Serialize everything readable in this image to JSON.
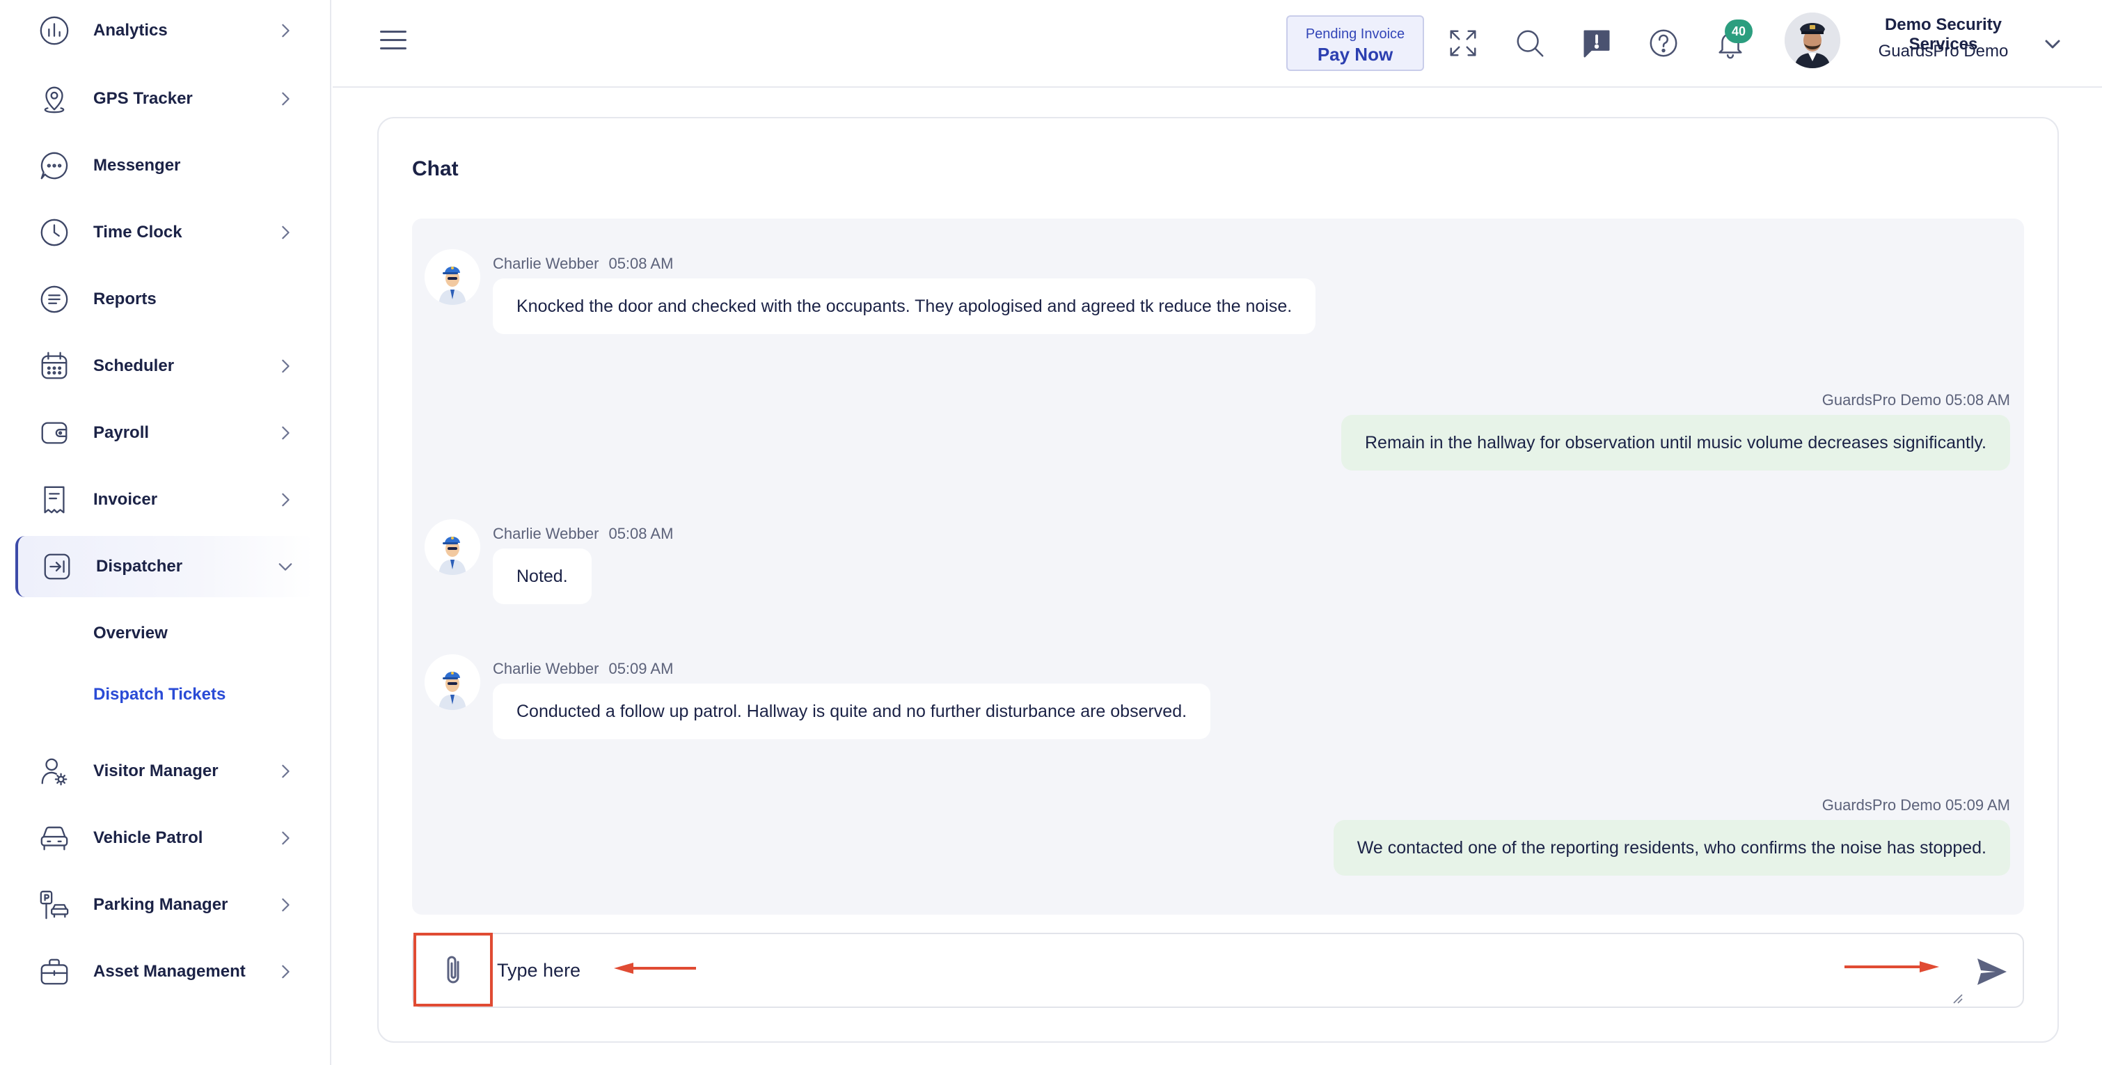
{
  "sidebar": {
    "items": [
      {
        "label": "Analytics",
        "icon": "analytics-icon",
        "has_chevron": true
      },
      {
        "label": "GPS Tracker",
        "icon": "location-pin-icon",
        "has_chevron": true
      },
      {
        "label": "Messenger",
        "icon": "chat-bubble-icon",
        "has_chevron": false
      },
      {
        "label": "Time Clock",
        "icon": "clock-icon",
        "has_chevron": true
      },
      {
        "label": "Reports",
        "icon": "report-icon",
        "has_chevron": false
      },
      {
        "label": "Scheduler",
        "icon": "calendar-icon",
        "has_chevron": true
      },
      {
        "label": "Payroll",
        "icon": "wallet-icon",
        "has_chevron": true
      },
      {
        "label": "Invoicer",
        "icon": "receipt-icon",
        "has_chevron": true
      },
      {
        "label": "Dispatcher",
        "icon": "dispatch-icon",
        "has_chevron": true,
        "expanded": true
      },
      {
        "label": "Visitor Manager",
        "icon": "visitor-icon",
        "has_chevron": true
      },
      {
        "label": "Vehicle Patrol",
        "icon": "car-icon",
        "has_chevron": true
      },
      {
        "label": "Parking Manager",
        "icon": "parking-icon",
        "has_chevron": true
      },
      {
        "label": "Asset Management",
        "icon": "briefcase-icon",
        "has_chevron": true
      }
    ],
    "dispatcher_sub": [
      {
        "label": "Overview",
        "active": false
      },
      {
        "label": "Dispatch Tickets",
        "active": true
      }
    ]
  },
  "header": {
    "pending_invoice": "Pending Invoice",
    "pay_now": "Pay Now",
    "notification_count": "40",
    "user_name": "Demo Security Services",
    "user_org": "GuardsPro Demo"
  },
  "chat": {
    "title": "Chat",
    "messages": [
      {
        "direction": "in",
        "sender": "Charlie Webber",
        "time": "05:08 AM",
        "text": "Knocked the door and checked with the occupants. They apologised and agreed tk reduce the noise."
      },
      {
        "direction": "out",
        "meta": "GuardsPro Demo 05:08 AM",
        "text": "Remain in the hallway for observation until music volume decreases significantly."
      },
      {
        "direction": "in",
        "sender": "Charlie Webber",
        "time": "05:08 AM",
        "text": "Noted."
      },
      {
        "direction": "in",
        "sender": "Charlie Webber",
        "time": "05:09 AM",
        "text": "Conducted a follow up patrol. Hallway is quite and no further disturbance are observed."
      },
      {
        "direction": "out",
        "meta": "GuardsPro Demo 05:09 AM",
        "text": "We contacted one of the reporting residents, who confirms the noise has stopped."
      }
    ],
    "input_placeholder": "Type here"
  },
  "colors": {
    "accent": "#2a4bd6",
    "badge": "#2c9e7f",
    "outgoing_bubble": "#e7f3e8",
    "annotation": "#e04b33"
  }
}
